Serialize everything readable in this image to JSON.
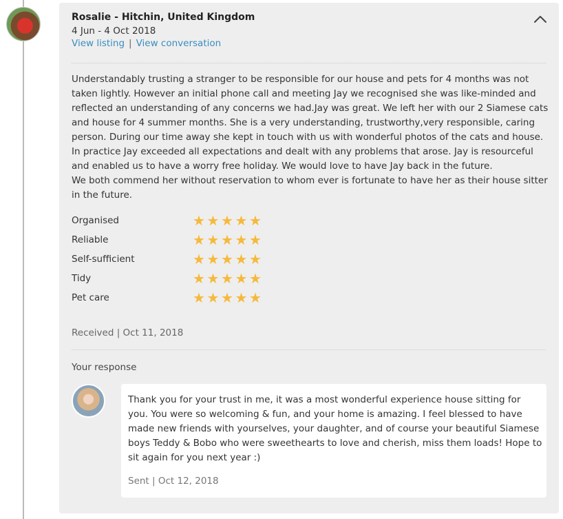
{
  "review": {
    "reviewer": "Rosalie - Hitchin, United Kingdom",
    "dates": "4 Jun - 4 Oct 2018",
    "links": {
      "listing": "View listing",
      "separator": "|",
      "conversation": "View conversation"
    },
    "text": [
      "Understandably trusting a stranger to be responsible for our house and pets for 4 months was not taken lightly. However an initial phone call and meeting Jay we recognised she was like-minded and reflected an understanding of any concerns we had.Jay was great. We left her with our 2 Siamese cats and house for 4 summer months. She is a very understanding, trustworthy,very responsible, caring person. During our time away she kept in touch with us with wonderful photos of the cats and house. In practice Jay exceeded all expectations and dealt with any problems that arose. Jay is resourceful and enabled us to have a worry free holiday. We would love to have Jay back in the future.",
      "We both commend her without reservation to whom ever is fortunate to have her as their house sitter in the future."
    ],
    "ratings": [
      {
        "label": "Organised",
        "stars": 5
      },
      {
        "label": "Reliable",
        "stars": 5
      },
      {
        "label": "Self-sufficient",
        "stars": 5
      },
      {
        "label": "Tidy",
        "stars": 5
      },
      {
        "label": "Pet care",
        "stars": 5
      }
    ],
    "star_glyph": "★",
    "received": "Received | Oct 11, 2018",
    "collapse_icon": "chevron-up-icon"
  },
  "response": {
    "heading": "Your response",
    "text": "Thank you for your trust in me, it was a most wonderful experience house sitting for you. You were so welcoming & fun, and your home is amazing. I feel blessed to have made new friends with yourselves, your daughter, and of course your beautiful Siamese boys Teddy & Bobo who were sweethearts to love and cherish, miss them loads! Hope to sit again for you next year :)",
    "sent": "Sent | Oct 12, 2018"
  },
  "colors": {
    "card_background": "#eeeeee",
    "link": "#3a8dc1",
    "star": "#f6b93b",
    "timeline": "#b9b9b9"
  }
}
